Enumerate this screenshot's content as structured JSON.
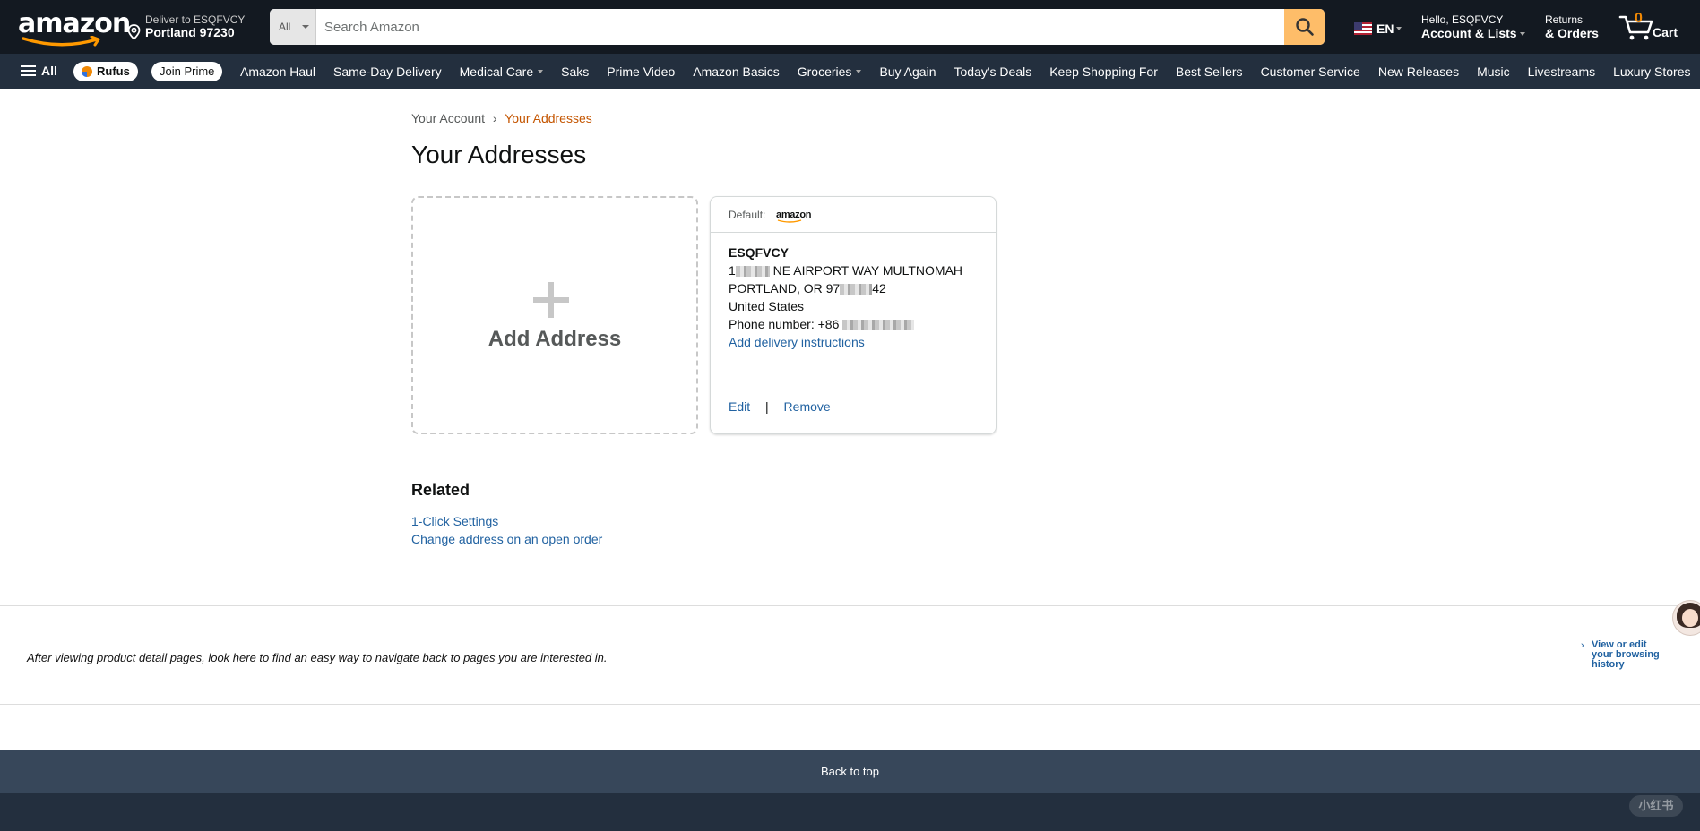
{
  "header": {
    "logo_text": "amazon",
    "deliver_line1": "Deliver to ESQFVCY",
    "deliver_line2": "Portland 97230",
    "search_category": "All",
    "search_placeholder": "Search Amazon",
    "language": "EN",
    "account_line1": "Hello, ESQFVCY",
    "account_line2": "Account & Lists",
    "returns_line1": "Returns",
    "returns_line2": "& Orders",
    "cart_count": "0",
    "cart_label": "Cart"
  },
  "subnav": {
    "all_label": "All",
    "rufus_label": "Rufus",
    "join_prime_label": "Join Prime",
    "links": [
      {
        "label": "Amazon Haul",
        "dropdown": false
      },
      {
        "label": "Same-Day Delivery",
        "dropdown": false
      },
      {
        "label": "Medical Care",
        "dropdown": true
      },
      {
        "label": "Saks",
        "dropdown": false
      },
      {
        "label": "Prime Video",
        "dropdown": false
      },
      {
        "label": "Amazon Basics",
        "dropdown": false
      },
      {
        "label": "Groceries",
        "dropdown": true
      },
      {
        "label": "Buy Again",
        "dropdown": false
      },
      {
        "label": "Today's Deals",
        "dropdown": false
      },
      {
        "label": "Keep Shopping For",
        "dropdown": false
      },
      {
        "label": "Best Sellers",
        "dropdown": false
      },
      {
        "label": "Customer Service",
        "dropdown": false
      },
      {
        "label": "New Releases",
        "dropdown": false
      },
      {
        "label": "Music",
        "dropdown": false
      },
      {
        "label": "Livestreams",
        "dropdown": false
      },
      {
        "label": "Luxury Stores",
        "dropdown": false
      }
    ]
  },
  "breadcrumb": {
    "parent": "Your Account",
    "separator": "›",
    "current": "Your Addresses"
  },
  "page_title": "Your Addresses",
  "add_address": {
    "label": "Add Address"
  },
  "address_card": {
    "default_label": "Default:",
    "default_brand": "amazon",
    "name": "ESQFVCY",
    "street_prefix": "1",
    "street_suffix": " NE AIRPORT WAY MULTNOMAH",
    "city_prefix": "PORTLAND, OR 97",
    "city_suffix": "42",
    "country": "United States",
    "phone_prefix": "Phone number: +86",
    "delivery_instructions": "Add delivery instructions",
    "edit_label": "Edit",
    "separator": "|",
    "remove_label": "Remove"
  },
  "related": {
    "title": "Related",
    "links": [
      "1-Click Settings",
      "Change address on an open order"
    ]
  },
  "browsing_history": {
    "message": "After viewing product detail pages, look here to find an easy way to navigate back to pages you are interested in.",
    "view_edit_label": "View or edit your browsing history"
  },
  "footer": {
    "back_to_top": "Back to top",
    "watermark": "小红书"
  },
  "colors": {
    "nav_dark": "#131921",
    "nav_sub": "#232f3e",
    "search_button": "#febd69",
    "link": "#2162a1",
    "breadcrumb_current": "#c45500",
    "cart_count": "#f08804"
  },
  "icons": [
    "search-icon",
    "location-pin-icon",
    "us-flag-icon",
    "cart-icon",
    "hamburger-menu-icon",
    "plus-icon",
    "chevron-right-icon"
  ]
}
